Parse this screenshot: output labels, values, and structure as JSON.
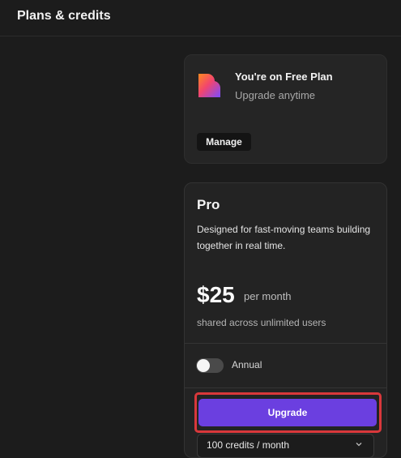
{
  "header": {
    "title": "Plans & credits"
  },
  "current_plan": {
    "title": "You're on Free Plan",
    "subtitle": "Upgrade anytime",
    "manage_label": "Manage"
  },
  "pro_plan": {
    "name": "Pro",
    "description": "Designed for fast-moving teams building together in real time.",
    "price": "$25",
    "price_period": "per month",
    "price_note": "shared across unlimited users",
    "annual_label": "Annual",
    "annual_enabled": false,
    "upgrade_label": "Upgrade",
    "credits_selected": "100 credits / month"
  },
  "colors": {
    "background": "#1c1c1c",
    "card": "#252525",
    "accent": "#6b3fe0",
    "highlight": "#d9383b"
  },
  "icons": {
    "logo": "heart-logo-icon",
    "dropdown": "chevron-down-icon"
  }
}
